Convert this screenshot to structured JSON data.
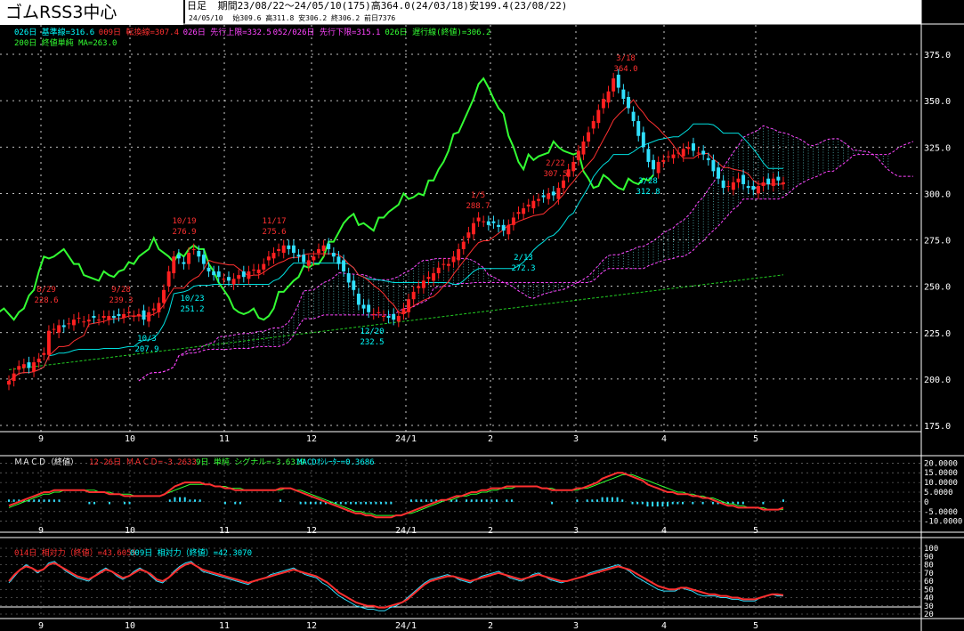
{
  "header": {
    "title": "ゴムRSS3中心",
    "period_label": "日足",
    "stats_line1": "期間23/08/22～24/05/10(175)高364.0(24/03/18)安199.4(23/08/22)",
    "date": "24/05/10",
    "stats_line2": "始309.6 高311.8 安306.2 終306.2 前日7376"
  },
  "legend": {
    "row1": [
      {
        "text": "026日 基準線=316.6",
        "color": "#00ffff"
      },
      {
        "text": "009日 転換線=307.4",
        "color": "#ff3030"
      },
      {
        "text": "026日 先行上限=332.5",
        "color": "#ff44ff"
      },
      {
        "text": "052/026日 先行下限=315.1",
        "color": "#ff44ff"
      },
      {
        "text": "026日 遅行線(終値)=306.2",
        "color": "#33ff33"
      }
    ],
    "row2": [
      {
        "text": "200日 終値単純 MA=263.0",
        "color": "#33ff33"
      }
    ]
  },
  "chart_data": [
    {
      "type": "candlestick",
      "title": "ゴムRSS3中心",
      "ylim": [
        175,
        385
      ],
      "yticks": [
        "375.0",
        "350.0",
        "325.0",
        "300.0",
        "275.0",
        "250.0",
        "225.0",
        "200.0",
        "175.0"
      ],
      "x_month_labels": [
        "9",
        "10",
        "11",
        "12",
        "24/1",
        "2",
        "3",
        "4",
        "5"
      ],
      "close_series": [
        199,
        203,
        207,
        208,
        206,
        209,
        211,
        214,
        226,
        227,
        229,
        228,
        230,
        232,
        233,
        231,
        232,
        233,
        232,
        234,
        234,
        233,
        234,
        235,
        236,
        234,
        235,
        232,
        236,
        238,
        241,
        248,
        258,
        266,
        265,
        262,
        268,
        270,
        266,
        262,
        258,
        256,
        255,
        254,
        253,
        254,
        256,
        255,
        258,
        259,
        259,
        262,
        266,
        268,
        270,
        272,
        270,
        268,
        266,
        263,
        264,
        266,
        270,
        272,
        270,
        266,
        262,
        258,
        252,
        248,
        240,
        238,
        236,
        235,
        236,
        234,
        233,
        232,
        234,
        238,
        243,
        247,
        250,
        253,
        255,
        257,
        260,
        262,
        262,
        266,
        270,
        274,
        279,
        284,
        287,
        285,
        283,
        284,
        282,
        280,
        283,
        287,
        290,
        292,
        294,
        296,
        297,
        298,
        300,
        299,
        303,
        307,
        313,
        317,
        323,
        328,
        333,
        339,
        345,
        351,
        355,
        362,
        357,
        351,
        346,
        339,
        331,
        325,
        317,
        313,
        317,
        318,
        320,
        321,
        322,
        324,
        325,
        323,
        322,
        321,
        318,
        312,
        308,
        303,
        304,
        306,
        308,
        305,
        303,
        302,
        304,
        306,
        305,
        308,
        307,
        306
      ],
      "annotations": [
        {
          "date": "8/29",
          "value": "228.6"
        },
        {
          "date": "9/28",
          "value": "239.3"
        },
        {
          "date": "10/19",
          "value": "276.9"
        },
        {
          "date": "10/23",
          "value": "251.2"
        },
        {
          "date": "10/3",
          "value": "207.9"
        },
        {
          "date": "11/17",
          "value": "275.6"
        },
        {
          "date": "12/20",
          "value": "232.5"
        },
        {
          "date": "1/5",
          "value": "288.7"
        },
        {
          "date": "2/13",
          "value": "272.3"
        },
        {
          "date": "2/22",
          "value": "307.5"
        },
        {
          "date": "3/18",
          "value": "364.0"
        },
        {
          "date": "3/28",
          "value": "312.8"
        }
      ],
      "series": [
        {
          "name": "026日 基準線",
          "last": 316.6
        },
        {
          "name": "009日 転換線",
          "last": 307.4
        },
        {
          "name": "026日 先行上限",
          "last": 332.5
        },
        {
          "name": "052/026日 先行下限",
          "last": 315.1
        },
        {
          "name": "026日 遅行線(終値)",
          "last": 306.2
        },
        {
          "name": "200日 終値単純 MA",
          "last": 263.0
        }
      ]
    },
    {
      "type": "line",
      "title": "ＭＡＣＤ（終値）",
      "legend": [
        {
          "text": "12-26日 ＭＡＣＤ=-3.2633",
          "color": "#ff3030"
        },
        {
          "text": "9日 単純 シグナル=-3.6319",
          "color": "#33ff33"
        },
        {
          "text": "MACDｵｼﾚｰﾀｰ=0.3686",
          "color": "#00ffff"
        }
      ],
      "ylim": [
        -12,
        22
      ],
      "yticks": [
        "20.0000",
        "15.0000",
        "10.0000",
        "5.0000",
        "0",
        "-5.0000",
        "-10.0000"
      ],
      "macd": [
        -2,
        -1,
        0,
        1,
        2,
        3,
        4,
        5,
        5,
        6,
        6,
        6,
        6,
        6,
        6,
        6,
        5,
        5,
        5,
        5,
        4,
        4,
        4,
        3,
        3,
        3,
        3,
        3,
        3,
        3,
        3,
        4,
        6,
        8,
        9,
        10,
        10,
        10,
        10,
        9,
        9,
        8,
        8,
        7,
        7,
        6,
        6,
        6,
        6,
        6,
        6,
        6,
        6,
        6,
        7,
        7,
        7,
        6,
        5,
        4,
        3,
        2,
        1,
        0,
        -1,
        -2,
        -3,
        -4,
        -5,
        -6,
        -6,
        -7,
        -7,
        -8,
        -8,
        -8,
        -8,
        -7,
        -7,
        -6,
        -5,
        -4,
        -3,
        -2,
        -1,
        0,
        1,
        1,
        2,
        3,
        3,
        4,
        5,
        5,
        6,
        6,
        7,
        7,
        7,
        8,
        8,
        8,
        8,
        8,
        8,
        8,
        7,
        7,
        6,
        6,
        6,
        6,
        6,
        7,
        7,
        8,
        9,
        10,
        12,
        13,
        14,
        15,
        15,
        14,
        13,
        12,
        11,
        9,
        8,
        7,
        6,
        5,
        5,
        4,
        4,
        4,
        3,
        3,
        2,
        2,
        1,
        0,
        -1,
        -2,
        -2,
        -3,
        -3,
        -3,
        -3,
        -3,
        -4,
        -4,
        -4,
        -4,
        -3
      ],
      "signal": [
        -3,
        -2,
        -1,
        0,
        1,
        2,
        3,
        4,
        4,
        5,
        5,
        6,
        6,
        6,
        6,
        6,
        6,
        6,
        5,
        5,
        5,
        4,
        4,
        4,
        4,
        3,
        3,
        3,
        3,
        3,
        3,
        4,
        5,
        6,
        7,
        8,
        9,
        9,
        9,
        9,
        9,
        8,
        8,
        8,
        7,
        7,
        7,
        6,
        6,
        6,
        6,
        6,
        6,
        6,
        6,
        7,
        7,
        6,
        6,
        5,
        4,
        3,
        2,
        1,
        0,
        -1,
        -2,
        -3,
        -4,
        -5,
        -5,
        -6,
        -6,
        -7,
        -7,
        -7,
        -7,
        -7,
        -7,
        -6,
        -6,
        -5,
        -4,
        -3,
        -2,
        -1,
        0,
        1,
        1,
        2,
        3,
        3,
        4,
        4,
        5,
        5,
        6,
        6,
        7,
        7,
        7,
        8,
        8,
        8,
        8,
        8,
        7,
        7,
        7,
        6,
        6,
        6,
        6,
        6,
        7,
        7,
        8,
        9,
        10,
        11,
        12,
        13,
        14,
        14,
        14,
        13,
        12,
        11,
        10,
        9,
        8,
        7,
        6,
        5,
        5,
        4,
        4,
        3,
        3,
        2,
        2,
        1,
        0,
        -1,
        -1,
        -2,
        -2,
        -3,
        -3,
        -3,
        -3,
        -4,
        -4,
        -4,
        -4
      ]
    },
    {
      "type": "line",
      "title": "相対力",
      "legend": [
        {
          "text": "014日 相対力（終値）=43.6055",
          "color": "#ff3030"
        },
        {
          "text": "009日 相対力（終値）=42.3070",
          "color": "#00ffff"
        }
      ],
      "ylim": [
        20,
        100
      ],
      "yticks": [
        "100",
        "90",
        "80",
        "70",
        "60",
        "50",
        "40",
        "30",
        "20"
      ],
      "rsi14": [
        60,
        68,
        74,
        78,
        76,
        72,
        74,
        80,
        82,
        78,
        74,
        70,
        66,
        64,
        62,
        66,
        70,
        74,
        72,
        68,
        64,
        66,
        70,
        74,
        72,
        68,
        62,
        60,
        64,
        70,
        76,
        80,
        82,
        78,
        74,
        72,
        70,
        68,
        66,
        64,
        62,
        60,
        58,
        60,
        62,
        64,
        66,
        68,
        70,
        72,
        74,
        72,
        70,
        68,
        66,
        62,
        58,
        52,
        46,
        42,
        38,
        34,
        32,
        30,
        30,
        28,
        28,
        30,
        32,
        34,
        38,
        44,
        50,
        56,
        60,
        62,
        64,
        66,
        66,
        64,
        62,
        60,
        62,
        64,
        66,
        68,
        70,
        68,
        66,
        64,
        62,
        64,
        66,
        68,
        66,
        64,
        62,
        60,
        60,
        62,
        64,
        66,
        68,
        70,
        72,
        74,
        76,
        78,
        76,
        74,
        70,
        66,
        62,
        58,
        54,
        52,
        50,
        50,
        52,
        52,
        50,
        48,
        46,
        44,
        44,
        42,
        42,
        40,
        40,
        38,
        38,
        38,
        40,
        42,
        44,
        44,
        43
      ],
      "rsi9": [
        58,
        66,
        74,
        80,
        76,
        70,
        74,
        82,
        84,
        78,
        72,
        68,
        64,
        62,
        60,
        66,
        72,
        76,
        72,
        66,
        62,
        66,
        72,
        76,
        72,
        66,
        60,
        58,
        64,
        72,
        78,
        82,
        84,
        78,
        72,
        70,
        68,
        66,
        64,
        62,
        60,
        58,
        56,
        60,
        62,
        64,
        68,
        70,
        72,
        74,
        76,
        72,
        68,
        66,
        64,
        58,
        54,
        48,
        42,
        38,
        34,
        30,
        28,
        26,
        26,
        24,
        24,
        28,
        30,
        34,
        40,
        46,
        52,
        58,
        62,
        64,
        66,
        68,
        66,
        62,
        60,
        58,
        62,
        66,
        68,
        70,
        72,
        68,
        64,
        62,
        60,
        64,
        68,
        70,
        66,
        62,
        60,
        58,
        60,
        62,
        64,
        66,
        70,
        72,
        74,
        76,
        78,
        80,
        76,
        72,
        66,
        62,
        58,
        54,
        50,
        48,
        48,
        48,
        52,
        50,
        48,
        44,
        42,
        42,
        42,
        40,
        40,
        38,
        38,
        36,
        36,
        36,
        40,
        42,
        44,
        42,
        42
      ]
    }
  ]
}
